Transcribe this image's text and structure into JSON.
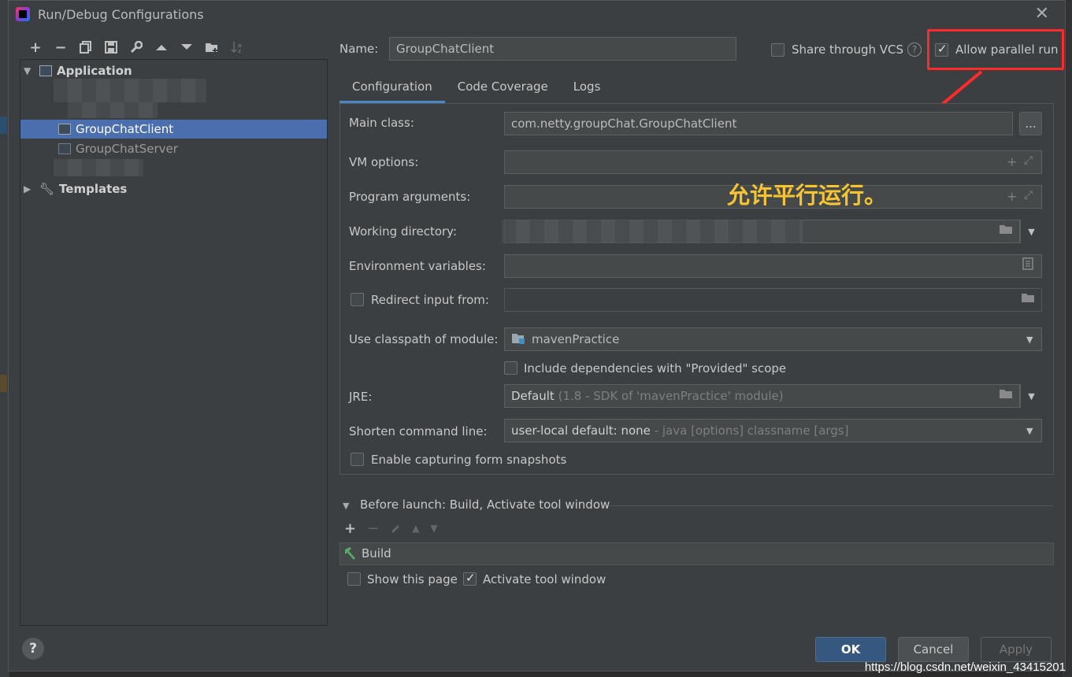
{
  "window": {
    "title": "Run/Debug Configurations"
  },
  "toolbar": {
    "icons": [
      "plus-icon",
      "minus-icon",
      "copy-icon",
      "save-icon",
      "wrench-icon",
      "arrow-up-icon",
      "arrow-down-icon",
      "folder-add-icon",
      "sort-icon"
    ]
  },
  "tree": {
    "group_label": "Application",
    "items": [
      "GroupChatClient",
      "GroupChatServer"
    ],
    "templates_label": "Templates"
  },
  "header": {
    "name_label": "Name:",
    "name_value": "GroupChatClient",
    "share_label": "Share through VCS",
    "allow_parallel_label": "Allow parallel run"
  },
  "tabs": [
    "Configuration",
    "Code Coverage",
    "Logs"
  ],
  "form": {
    "main_class_label": "Main class:",
    "main_class_value": "com.netty.groupChat.GroupChatClient",
    "vm_options_label": "VM options:",
    "program_args_label": "Program arguments:",
    "working_dir_label": "Working directory:",
    "env_vars_label": "Environment variables:",
    "redirect_label": "Redirect input from:",
    "classpath_label": "Use classpath of module:",
    "classpath_value": "mavenPractice",
    "include_deps_label": "Include dependencies with \"Provided\" scope",
    "jre_label": "JRE:",
    "jre_value": "Default",
    "jre_hint": "(1.8 - SDK of 'mavenPractice' module)",
    "shorten_label": "Shorten command line:",
    "shorten_value": "user-local default: none",
    "shorten_hint": "- java [options] classname [args]",
    "snapshots_label": "Enable capturing form snapshots"
  },
  "before_launch": {
    "title": "Before launch: Build, Activate tool window",
    "task": "Build",
    "show_page_label": "Show this page",
    "activate_label": "Activate tool window"
  },
  "annotation": {
    "text": "允许平行运行。",
    "color": "#f5c430",
    "box_color": "#ff2b2b"
  },
  "buttons": {
    "ok": "OK",
    "cancel": "Cancel",
    "apply": "Apply"
  },
  "help": "?",
  "watermark": "https://blog.csdn.net/weixin_43415201"
}
